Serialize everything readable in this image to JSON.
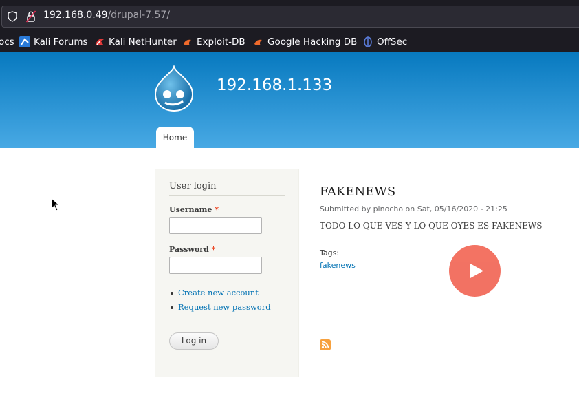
{
  "browser": {
    "url_host": "192.168.0.49",
    "url_path": "/drupal-7.57/",
    "bookmarks": [
      {
        "label": "ocs",
        "icon": "folder-icon"
      },
      {
        "label": "Kali Forums",
        "icon": "kali-icon"
      },
      {
        "label": "Kali NetHunter",
        "icon": "nethunter-icon"
      },
      {
        "label": "Exploit-DB",
        "icon": "exploitdb-icon"
      },
      {
        "label": "Google Hacking DB",
        "icon": "ghdb-icon"
      },
      {
        "label": "OffSec",
        "icon": "offsec-icon"
      }
    ]
  },
  "site": {
    "name": "192.168.1.133",
    "nav": {
      "home": "Home"
    }
  },
  "login": {
    "title": "User login",
    "username_label": "Username",
    "password_label": "Password",
    "required_mark": "*",
    "username_value": "",
    "password_value": "",
    "links": [
      "Create new account",
      "Request new password"
    ],
    "submit": "Log in"
  },
  "article": {
    "title": "FAKENEWS",
    "submitted": "Submitted by pinocho on Sat, 05/16/2020 - 21:25",
    "body": "TODO LO QUE VES Y LO QUE OYES ES FAKENEWS",
    "tags_label": "Tags:",
    "tags": [
      "fakenews"
    ]
  },
  "colors": {
    "header_top": "#0779bf",
    "header_bottom": "#48a9e4",
    "link": "#0071b3",
    "play_button": "#f26b5b"
  }
}
